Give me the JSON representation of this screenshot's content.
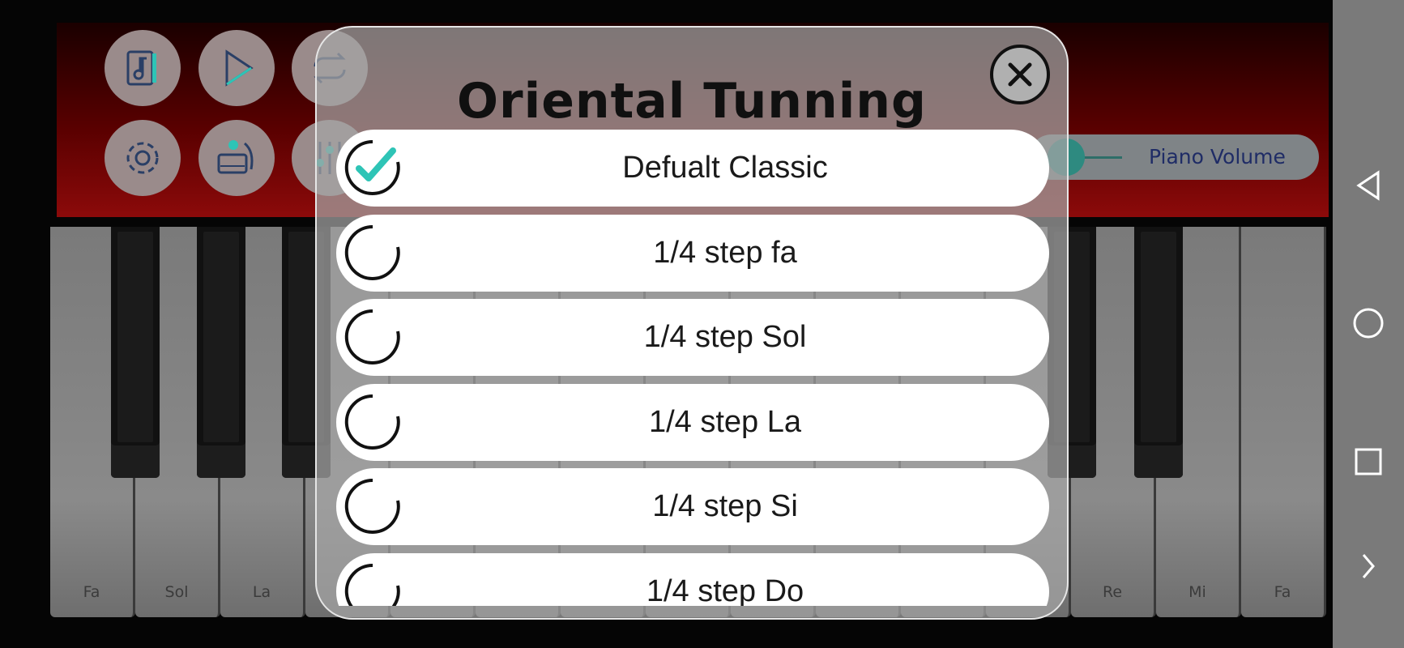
{
  "dialog": {
    "title": "Oriental Tunning",
    "options": [
      {
        "label": "Defualt Classic",
        "selected": true
      },
      {
        "label": "1/4 step fa",
        "selected": false
      },
      {
        "label": "1/4 step Sol",
        "selected": false
      },
      {
        "label": "1/4 step La",
        "selected": false
      },
      {
        "label": "1/4 step Si",
        "selected": false
      },
      {
        "label": "1/4 step Do",
        "selected": false
      }
    ]
  },
  "toolbar": {
    "buttons": [
      "music-file-icon",
      "play-icon",
      "repeat-icon",
      "settings-icon",
      "instrument-icon",
      "equalizer-icon"
    ]
  },
  "volume": {
    "label": "Piano Volume",
    "level": 0.1
  },
  "piano": {
    "notes_left": [
      "Fa",
      "Sol",
      "La"
    ],
    "notes_right": [
      "Re",
      "Mi",
      "Fa"
    ]
  },
  "colors": {
    "accent": "#2ec4b6",
    "dialog_bg": "#a5a5a5",
    "top_band": "#8c0a0a"
  }
}
